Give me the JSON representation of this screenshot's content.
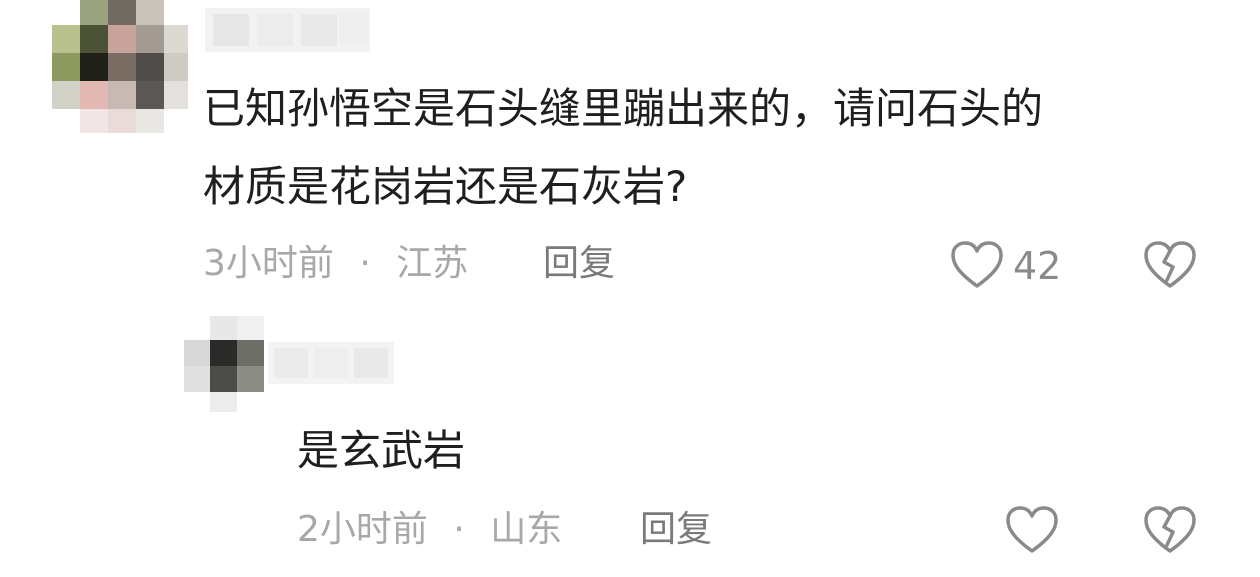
{
  "comment": {
    "text_line1": "已知孙悟空是石头缝里蹦出来的，请问石头的",
    "text_line2": "材质是花岗岩还是石灰岩?",
    "time": "3小时前",
    "separator": "·",
    "location": "江苏",
    "reply_label": "回复",
    "like_count": "42",
    "like_icon": "heart-outline-icon",
    "dislike_icon": "broken-heart-icon"
  },
  "reply": {
    "text": "是玄武岩",
    "time": "2小时前",
    "separator": "·",
    "location": "山东",
    "reply_label": "回复",
    "like_icon": "heart-outline-icon",
    "dislike_icon": "broken-heart-icon"
  },
  "colors": {
    "text": "#1f1f1f",
    "meta": "#a8a8a8",
    "icon": "#8a8a8a"
  }
}
